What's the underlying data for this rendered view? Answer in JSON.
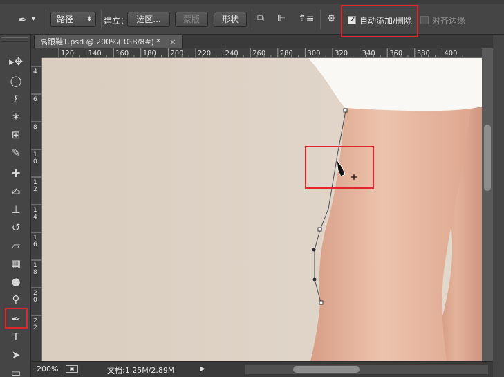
{
  "options_bar": {
    "mode_select": "路径",
    "create_label": "建立：",
    "selection_button": "选区...",
    "mask_button": "蒙版",
    "shape_button": "形状",
    "auto_add_delete": {
      "label": "自动添加/删除",
      "checked": true
    },
    "align_edges": {
      "label": "对齐边缘",
      "checked": false
    },
    "dropdown_arrow": "▾"
  },
  "document": {
    "tab_title": "高跟鞋1.psd @ 200%(RGB/8#) *",
    "close": "×",
    "more": "»"
  },
  "ruler": {
    "top_labels": [
      "120",
      "140",
      "160",
      "180",
      "200",
      "220",
      "240",
      "260",
      "280",
      "300",
      "320",
      "340",
      "360",
      "380",
      "400"
    ],
    "left_labels": [
      "4",
      "6",
      "8",
      "1\n0",
      "1\n2",
      "1\n4",
      "1\n6",
      "1\n8",
      "2\n0",
      "2\n2"
    ]
  },
  "status": {
    "zoom": "200%",
    "doc_info": "文档:1.25M/2.89M",
    "arrow": "▶"
  },
  "colors": {
    "highlight": "#e0262c",
    "canvas_bg": "#ddd3c6",
    "skin": "#e4b49d",
    "skirt": "#faf8f4"
  },
  "tools": [
    {
      "name": "move-tool-icon",
      "glyph": "▸✥"
    },
    {
      "name": "marquee-tool-icon",
      "glyph": "◯"
    },
    {
      "name": "lasso-tool-icon",
      "glyph": "ℓ"
    },
    {
      "name": "magic-wand-tool-icon",
      "glyph": "✶"
    },
    {
      "name": "crop-tool-icon",
      "glyph": "⊞"
    },
    {
      "name": "eyedropper-tool-icon",
      "glyph": "✎"
    },
    {
      "name": "healing-brush-tool-icon",
      "glyph": "✚"
    },
    {
      "name": "brush-tool-icon",
      "glyph": "✍"
    },
    {
      "name": "clone-stamp-tool-icon",
      "glyph": "⊥"
    },
    {
      "name": "history-brush-tool-icon",
      "glyph": "↺"
    },
    {
      "name": "eraser-tool-icon",
      "glyph": "▱"
    },
    {
      "name": "gradient-tool-icon",
      "glyph": "▦"
    },
    {
      "name": "blur-tool-icon",
      "glyph": "●"
    },
    {
      "name": "dodge-tool-icon",
      "glyph": "⚲"
    },
    {
      "name": "pen-tool-icon",
      "glyph": "✒"
    },
    {
      "name": "type-tool-icon",
      "glyph": "T"
    },
    {
      "name": "path-selection-tool-icon",
      "glyph": "➤"
    },
    {
      "name": "shape-tool-icon",
      "glyph": "▭"
    }
  ]
}
